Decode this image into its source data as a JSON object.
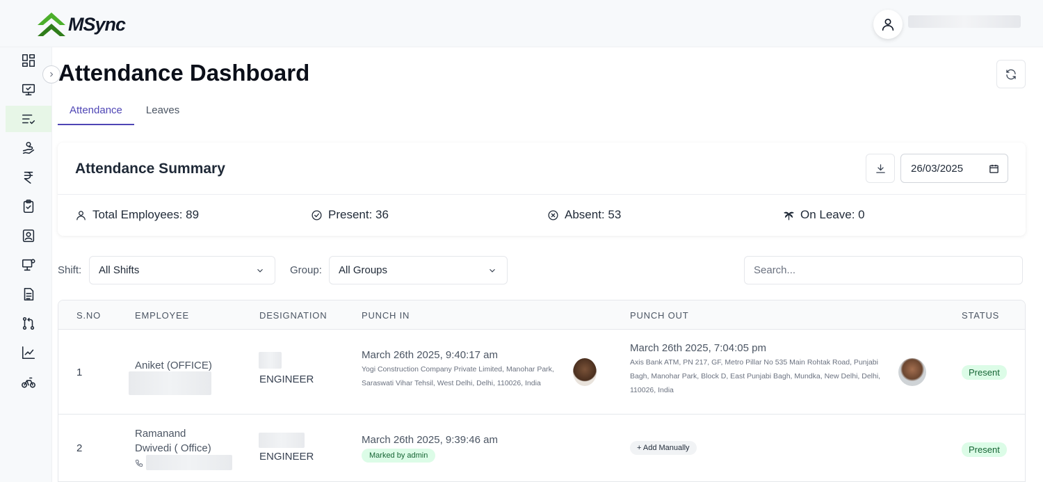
{
  "app": {
    "logo_text": "MSync"
  },
  "page": {
    "title": "Attendance Dashboard"
  },
  "tabs": [
    {
      "label": "Attendance",
      "active": true
    },
    {
      "label": "Leaves",
      "active": false
    }
  ],
  "summary": {
    "title": "Attendance Summary",
    "date_value": "26/03/2025",
    "stats": {
      "total": "Total Employees: 89",
      "present": "Present: 36",
      "absent": "Absent: 53",
      "on_leave": "On Leave: 0"
    }
  },
  "filters": {
    "shift_label": "Shift:",
    "shift_value": "All Shifts",
    "group_label": "Group:",
    "group_value": "All Groups",
    "search_placeholder": "Search..."
  },
  "table": {
    "columns": [
      "S.NO",
      "EMPLOYEE",
      "DESIGNATION",
      "PUNCH IN",
      "PUNCH OUT",
      "STATUS"
    ],
    "rows": [
      {
        "sno": "1",
        "employee": "Aniket (OFFICE)",
        "designation": "ENGINEER",
        "punch_in_time": "March 26th 2025, 9:40:17 am",
        "punch_in_address": "Yogi Construction Company Private Limited, Manohar Park, Saraswati Vihar Tehsil, West Delhi, Delhi, 110026, India",
        "punch_out_time": "March 26th 2025, 7:04:05 pm",
        "punch_out_address": "Axis Bank ATM, PN 217, GF, Metro Pillar No 535 Main Rohtak Road, Punjabi Bagh, Manohar Park, Block D, East Punjabi Bagh, Mundka, New Delhi, Delhi, 110026, India",
        "status": "Present"
      },
      {
        "sno": "2",
        "employee": "Ramanand Dwivedi ( Office)",
        "designation": "ENGINEER",
        "punch_in_time": "March 26th 2025, 9:39:46 am",
        "punch_in_badge": "Marked by admin",
        "punch_out_action": "Add Manually",
        "status": "Present"
      }
    ]
  },
  "colors": {
    "accent": "#4f46b5",
    "brand_green": "#4caf2b",
    "present_bg": "#dcfce7",
    "present_text": "#166534"
  },
  "icons": [
    "dashboard-icon",
    "monitor-icon",
    "list-check-icon",
    "payments-icon",
    "rupee-icon",
    "clipboard-check-icon",
    "id-badge-icon",
    "monitor-user-icon",
    "document-icon",
    "git-pull-icon",
    "chart-icon",
    "bicycle-icon",
    "user-icon",
    "refresh-icon",
    "download-icon",
    "calendar-icon",
    "chevron-down-icon",
    "chevron-right-icon",
    "phone-icon",
    "plus-icon"
  ]
}
